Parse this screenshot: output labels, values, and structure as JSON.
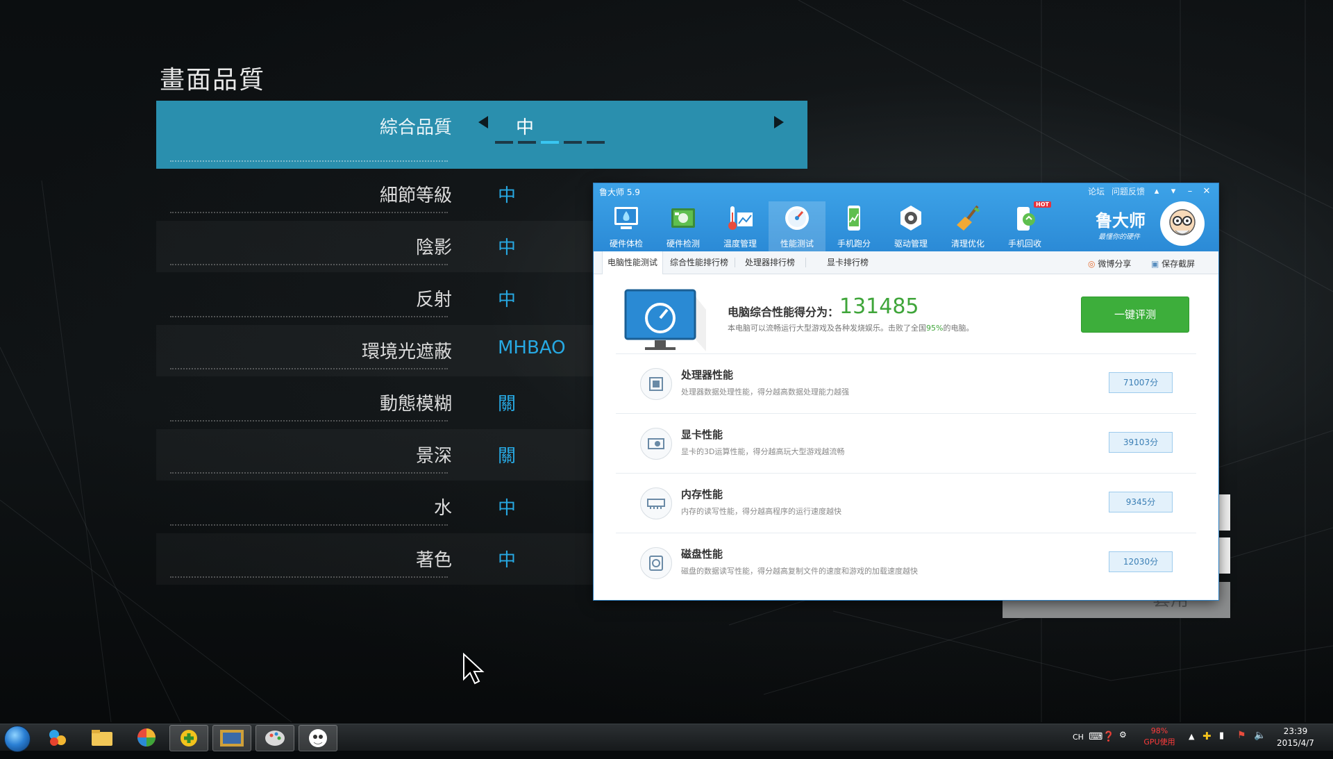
{
  "game": {
    "title": "畫面品質",
    "rows": [
      {
        "label": "綜合品質",
        "value": "中"
      },
      {
        "label": "細節等級",
        "value": "中"
      },
      {
        "label": "陰影",
        "value": "中"
      },
      {
        "label": "反射",
        "value": "中"
      },
      {
        "label": "環境光遮蔽",
        "value": "MHBAO"
      },
      {
        "label": "動態模糊",
        "value": "關"
      },
      {
        "label": "景深",
        "value": "關"
      },
      {
        "label": "水",
        "value": "中"
      },
      {
        "label": "著色",
        "value": "中"
      }
    ],
    "quality_level": {
      "current": 3,
      "total": 5
    },
    "apply_label": "套用"
  },
  "ludashi": {
    "title": "鲁大师 5.9",
    "top_menu": [
      "论坛",
      "问题反馈"
    ],
    "nav": [
      {
        "label": "硬件体检",
        "icon": "health-check-icon"
      },
      {
        "label": "硬件检测",
        "icon": "hardware-board-icon"
      },
      {
        "label": "温度管理",
        "icon": "thermometer-icon"
      },
      {
        "label": "性能测试",
        "icon": "speedometer-icon",
        "active": true
      },
      {
        "label": "手机跑分",
        "icon": "phone-benchmark-icon"
      },
      {
        "label": "驱动管理",
        "icon": "driver-gear-icon"
      },
      {
        "label": "清理优化",
        "icon": "broom-icon"
      },
      {
        "label": "手机回收",
        "icon": "phone-recycle-icon",
        "badge": "HOT"
      }
    ],
    "brand": "鲁大师",
    "slogan": "最懂你的硬件",
    "tabs": [
      "电脑性能测试",
      "综合性能排行榜",
      "处理器排行榜",
      "显卡排行榜"
    ],
    "share": {
      "weibo": "微博分享",
      "screenshot": "保存截屏"
    },
    "score": {
      "label": "电脑综合性能得分为：",
      "value": "131485",
      "desc_pre": "本电脑可以流畅运行大型游戏及各种发烧娱乐。击败了全国",
      "percent": "95%",
      "desc_post": "的电脑。"
    },
    "eval_button": "一键评测",
    "items": [
      {
        "title": "处理器性能",
        "desc": "处理器数据处理性能，得分越高数据处理能力越强",
        "score": "71007分",
        "icon": "cpu-icon"
      },
      {
        "title": "显卡性能",
        "desc": "显卡的3D运算性能，得分越高玩大型游戏越流畅",
        "score": "39103分",
        "icon": "graphics-card-icon"
      },
      {
        "title": "内存性能",
        "desc": "内存的读写性能，得分越高程序的运行速度越快",
        "score": "9345分",
        "icon": "memory-icon"
      },
      {
        "title": "磁盘性能",
        "desc": "磁盘的数据读写性能，得分越高复制文件的速度和游戏的加载速度越快",
        "score": "12030分",
        "icon": "disk-icon"
      }
    ]
  },
  "taskbar": {
    "lang": "CH",
    "gpu_percent": "98%",
    "gpu_label": "GPU使用",
    "time": "23:39",
    "date": "2015/4/7"
  },
  "colors": {
    "accent_blue": "#27a9e3",
    "selected_row": "#2a8fae",
    "score_green": "#3fa53a",
    "ludashi_blue": "#2b8ad6"
  }
}
